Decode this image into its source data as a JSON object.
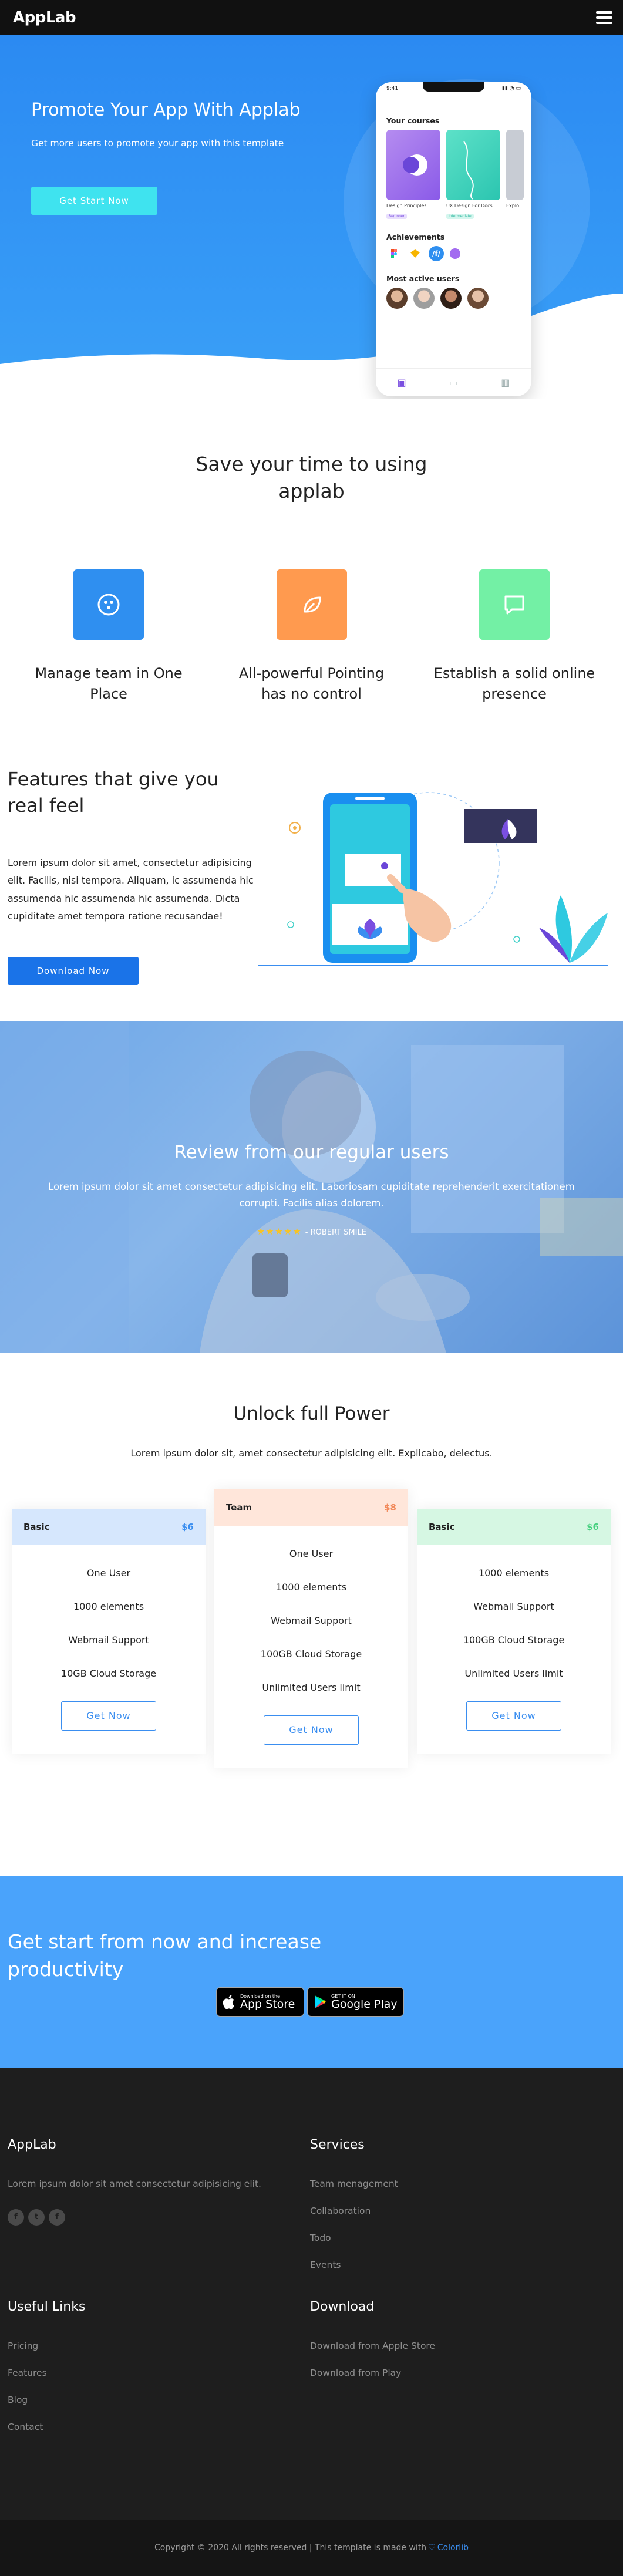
{
  "header": {
    "brand": "AppLab",
    "menu_icon": "hamburger-menu-icon"
  },
  "hero": {
    "title": "Promote Your App With Applab",
    "subtitle": "Get more users to promote your app with this template",
    "cta": "Get Start Now",
    "phone": {
      "time": "9:41",
      "courses_title": "Your courses",
      "courses": [
        {
          "name": "Design Principles",
          "tag": "Beginner"
        },
        {
          "name": "UX Design For Docs",
          "tag": "Intermediate"
        },
        {
          "name": "Explo",
          "tag": ""
        }
      ],
      "achievements_title": "Achievements",
      "active_users_title": "Most active users"
    }
  },
  "save": {
    "title": "Save your time to using applab",
    "items": [
      {
        "label": "Manage team in One Place",
        "icon": "team-icon",
        "color": "#2f8ff0"
      },
      {
        "label": "All-powerful Pointing has no control",
        "icon": "leaf-icon",
        "color": "#ff9a4f"
      },
      {
        "label": "Establish a solid online presence",
        "icon": "chat-icon",
        "color": "#73f0a5"
      }
    ]
  },
  "features": {
    "title": "Features that give you real feel",
    "text": "Lorem ipsum dolor sit amet, consectetur adipisicing elit. Facilis, nisi tempora. Aliquam, ic assumenda hic assumenda hic assumenda hic assumenda. Dicta cupiditate amet tempora ratione recusandae!",
    "cta": "Download Now"
  },
  "review": {
    "title": "Review from our regular users",
    "text": "Lorem ipsum dolor sit amet consectetur adipisicing elit. Laboriosam cupiditate reprehenderit exercitationem corrupti. Facilis alias dolorem.",
    "stars": 5,
    "author": "- ROBERT SMILE"
  },
  "pricing": {
    "title": "Unlock full Power",
    "subtitle": "Lorem ipsum dolor sit, amet consectetur adipisicing elit. Explicabo, delectus.",
    "plans": [
      {
        "name": "Basic",
        "price": "$6",
        "head_bg": "#d6e7fd",
        "price_color": "#3a8ef0",
        "features": [
          "One User",
          "1000 elements",
          "Webmail Support",
          "10GB Cloud Storage"
        ],
        "cta": "Get Now"
      },
      {
        "name": "Team",
        "price": "$8",
        "head_bg": "#ffe6da",
        "price_color": "#f28a5b",
        "features": [
          "One User",
          "1000 elements",
          "Webmail Support",
          "100GB Cloud Storage",
          "Unlimited Users limit"
        ],
        "cta": "Get Now"
      },
      {
        "name": "Basic",
        "price": "$6",
        "head_bg": "#d6f7e3",
        "price_color": "#46d07f",
        "features": [
          "1000 elements",
          "Webmail Support",
          "100GB Cloud Storage",
          "Unlimited Users limit"
        ],
        "cta": "Get Now"
      }
    ]
  },
  "cta": {
    "title": "Get start from now and increase productivity",
    "app_store": {
      "small": "Download on the",
      "large": "App Store"
    },
    "google_play": {
      "small": "GET IT ON",
      "large": "Google Play"
    }
  },
  "footer": {
    "about_title": "AppLab",
    "about_text": "Lorem ipsum dolor sit amet consectetur adipisicing elit.",
    "social": [
      "f",
      "t",
      "f"
    ],
    "services_title": "Services",
    "services": [
      "Team menagement",
      "Collaboration",
      "Todo",
      "Events"
    ],
    "links_title": "Useful Links",
    "links": [
      "Pricing",
      "Features",
      "Blog",
      "Contact"
    ],
    "download_title": "Download",
    "downloads": [
      "Download from Apple Store",
      "Download from Play"
    ],
    "copyright": "Copyright © 2020 All rights reserved | This template is made with",
    "made_by": "Colorlib"
  }
}
